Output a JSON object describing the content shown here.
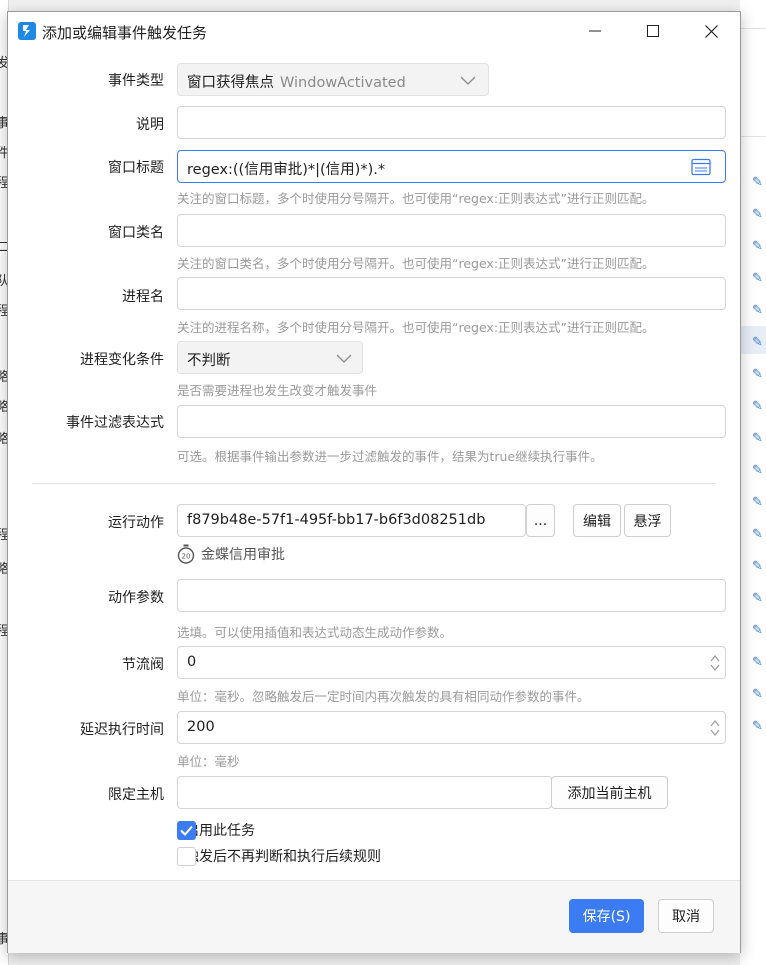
{
  "window": {
    "title": "添加或编辑事件触发任务",
    "minimize_icon": "minimize-icon",
    "maximize_icon": "maximize-icon",
    "close_icon": "close-icon"
  },
  "background": {
    "left_chars": [
      "发",
      "事",
      "件",
      "程",
      "二",
      "队",
      "程",
      "略",
      "略",
      "略",
      "程",
      "略",
      "程",
      "事"
    ]
  },
  "form": {
    "event_type": {
      "label": "事件类型",
      "value": "窗口获得焦点",
      "value_sub": "WindowActivated"
    },
    "description": {
      "label": "说明",
      "value": ""
    },
    "window_title": {
      "label": "窗口标题",
      "value": "regex:((信用审批)*|(信用)*).*",
      "hint": "关注的窗口标题，多个时使用分号隔开。也可使用“regex:正则表达式”进行正则匹配。"
    },
    "window_class": {
      "label": "窗口类名",
      "value": "",
      "hint": "关注的窗口类名，多个时使用分号隔开。也可使用“regex:正则表达式”进行正则匹配。"
    },
    "process_name": {
      "label": "进程名",
      "value": "",
      "hint": "关注的进程名称，多个时使用分号隔开。也可使用“regex:正则表达式”进行正则匹配。"
    },
    "process_change": {
      "label": "进程变化条件",
      "value": "不判断",
      "hint": "是否需要进程也发生改变才触发事件"
    },
    "event_filter": {
      "label": "事件过滤表达式",
      "value": "",
      "hint": "可选。根据事件输出参数进一步过滤触发的事件，结果为true继续执行事件。"
    },
    "run_action": {
      "label": "运行动作",
      "value": "f879b48e-57f1-495f-bb17-b6f3d08251db",
      "browse_label": "...",
      "edit_label": "编辑",
      "float_label": "悬浮",
      "action_name": "金蝶信用审批",
      "action_badge": "20"
    },
    "action_params": {
      "label": "动作参数",
      "value": "",
      "hint": "选填。可以使用插值和表达式动态生成动作参数。"
    },
    "throttle": {
      "label": "节流阀",
      "value": "0",
      "hint": "单位：毫秒。忽略触发后一定时间内再次触发的具有相同动作参数的事件。"
    },
    "delay": {
      "label": "延迟执行时间",
      "value": "200",
      "hint": "单位：毫秒"
    },
    "host": {
      "label": "限定主机",
      "value": "",
      "add_host_label": "添加当前主机"
    },
    "enable_task": {
      "label": "启用此任务",
      "checked": true
    },
    "stop_after": {
      "label": "触发后不再判断和执行后续规则",
      "checked": false
    }
  },
  "footer": {
    "save_label": "保存(S)",
    "cancel_label": "取消"
  },
  "colors": {
    "accent": "#3b7cf2",
    "hint": "#9a9a9a",
    "border": "#d4d4d4"
  }
}
